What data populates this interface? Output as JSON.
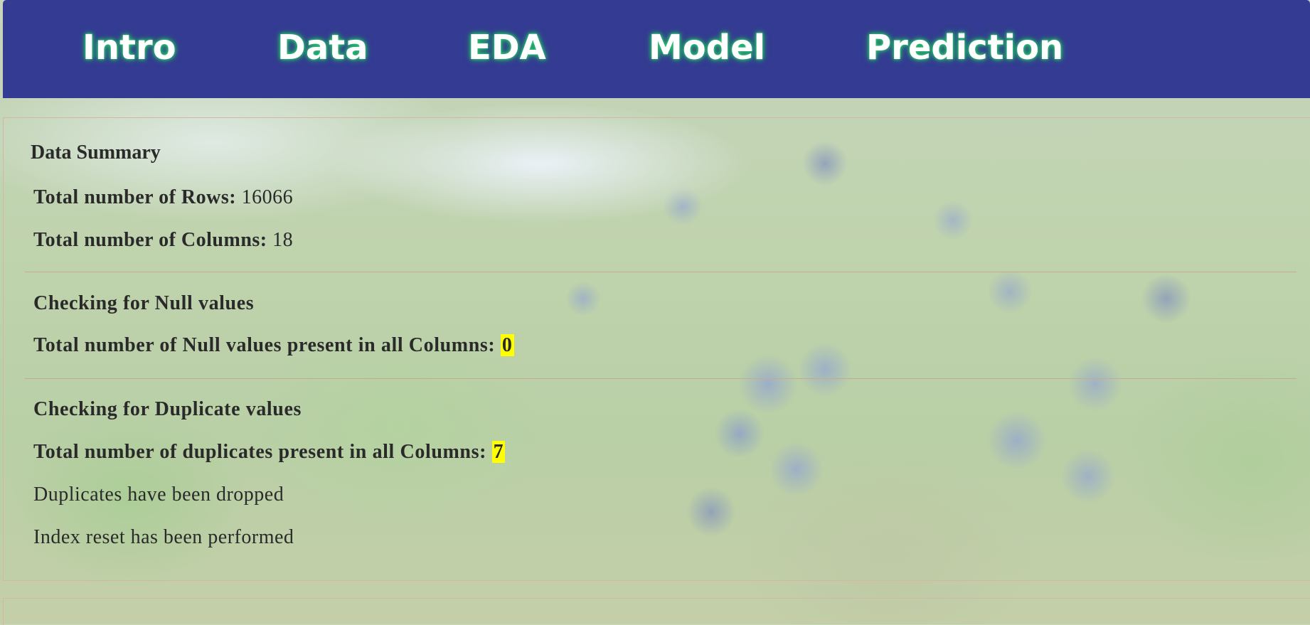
{
  "nav": {
    "items": [
      "Intro",
      "Data",
      "EDA",
      "Model",
      "Prediction"
    ]
  },
  "summary": {
    "title": "Data Summary",
    "rows_label": "Total number of Rows:",
    "rows_value": "16066",
    "cols_label": "Total number of Columns:",
    "cols_value": "18"
  },
  "nulls": {
    "heading": "Checking for Null values",
    "label": "Total number of Null values present in all Columns:",
    "value": "0"
  },
  "duplicates": {
    "heading": "Checking for Duplicate values",
    "label": "Total number of duplicates present in all Columns:",
    "value": "7",
    "dropped_msg": "Duplicates have been dropped",
    "reset_msg": "Index reset has been performed"
  },
  "colors": {
    "header_bg": "#343b92",
    "nav_glow": "#2fd07a",
    "highlight": "#ffff00",
    "divider": "#c9a98e"
  }
}
